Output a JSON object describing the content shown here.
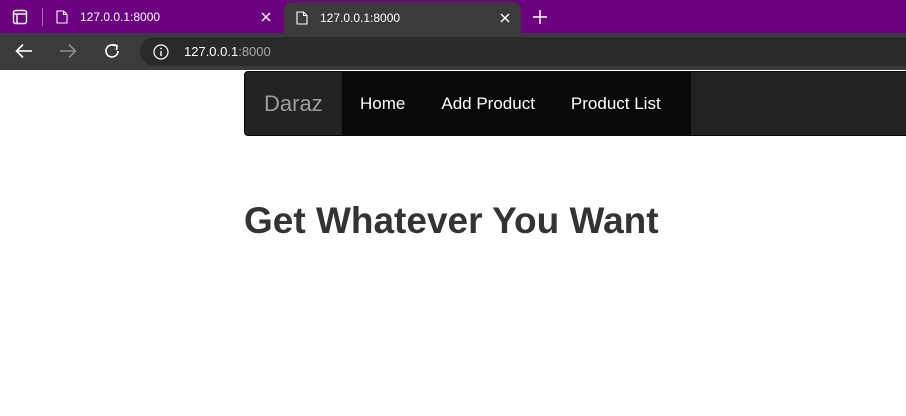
{
  "browser": {
    "tabs": [
      {
        "title": "127.0.0.1:8000",
        "active": false
      },
      {
        "title": "127.0.0.1:8000",
        "active": true
      }
    ],
    "address": {
      "host": "127.0.0.1",
      "port": ":8000"
    },
    "colors": {
      "tabstrip": "#6b0080",
      "toolbar": "#3b3b3b"
    }
  },
  "navbar": {
    "brand": "Daraz",
    "links": [
      {
        "label": "Home"
      },
      {
        "label": "Add Product"
      },
      {
        "label": "Product List"
      }
    ]
  },
  "hero": {
    "heading": "Get Whatever You Want"
  }
}
